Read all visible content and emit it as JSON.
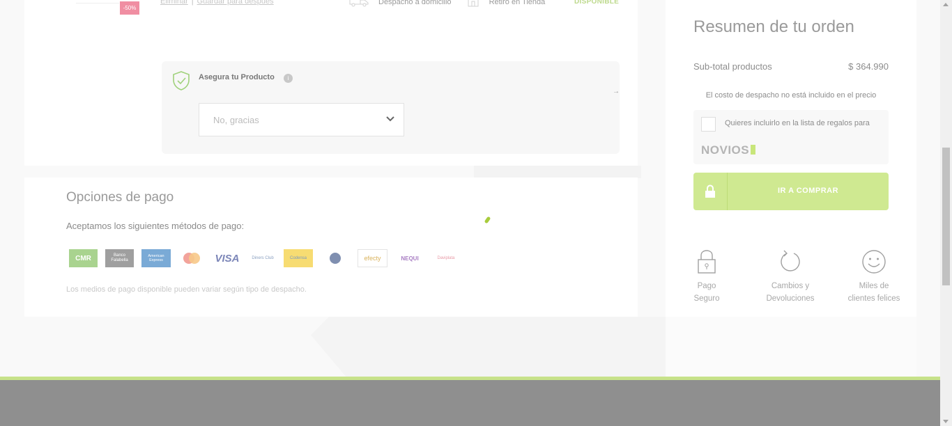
{
  "cart": {
    "discount_badge": "-50%",
    "remove_link": "Eliminar",
    "link_separator": "|",
    "save_later_link": "Guardar para después",
    "home_delivery": "Despacho a domicilio",
    "store_pickup": "Retiro en Tienda",
    "availability": "DISPONIBLE"
  },
  "insurance": {
    "title": "Asegura tu Producto",
    "info_glyph": "i",
    "select_value": "No, gracias",
    "arrow_glyph": "→"
  },
  "payment": {
    "title": "Opciones de pago",
    "subtitle": "Aceptamos los siguientes métodos de pago:",
    "methods": [
      "CMR",
      "Banco Falabella",
      "American Express",
      "Mastercard",
      "VISA",
      "Diners Club",
      "Codensa",
      "Servibanca",
      "efecty",
      "NEQUI",
      "Daviplata"
    ],
    "note": "Los medios de pago disponible pueden variar según tipo de despacho."
  },
  "summary": {
    "title": "Resumen de tu orden",
    "subtotal_label": "Sub-total productos",
    "subtotal_value": "$ 364.990",
    "shipping_note": "El costo de despacho no está incluido en el precio",
    "gift_text": "Quieres incluirlo en la lista de regalos para",
    "novios_brand": "NOVIOS",
    "buy_button": "IR A COMPRAR",
    "features": [
      {
        "line1": "Pago",
        "line2": "Seguro",
        "icon": "padlock-icon"
      },
      {
        "line1": "Cambios y",
        "line2": "Devoluciones",
        "icon": "refresh-icon"
      },
      {
        "line1": "Miles de",
        "line2": "clientes felices",
        "icon": "smiley-icon"
      }
    ]
  },
  "colors": {
    "accent_green": "#cfe991",
    "discount_pink": "#f08ea2",
    "footer_gray": "#8f8f8f"
  }
}
